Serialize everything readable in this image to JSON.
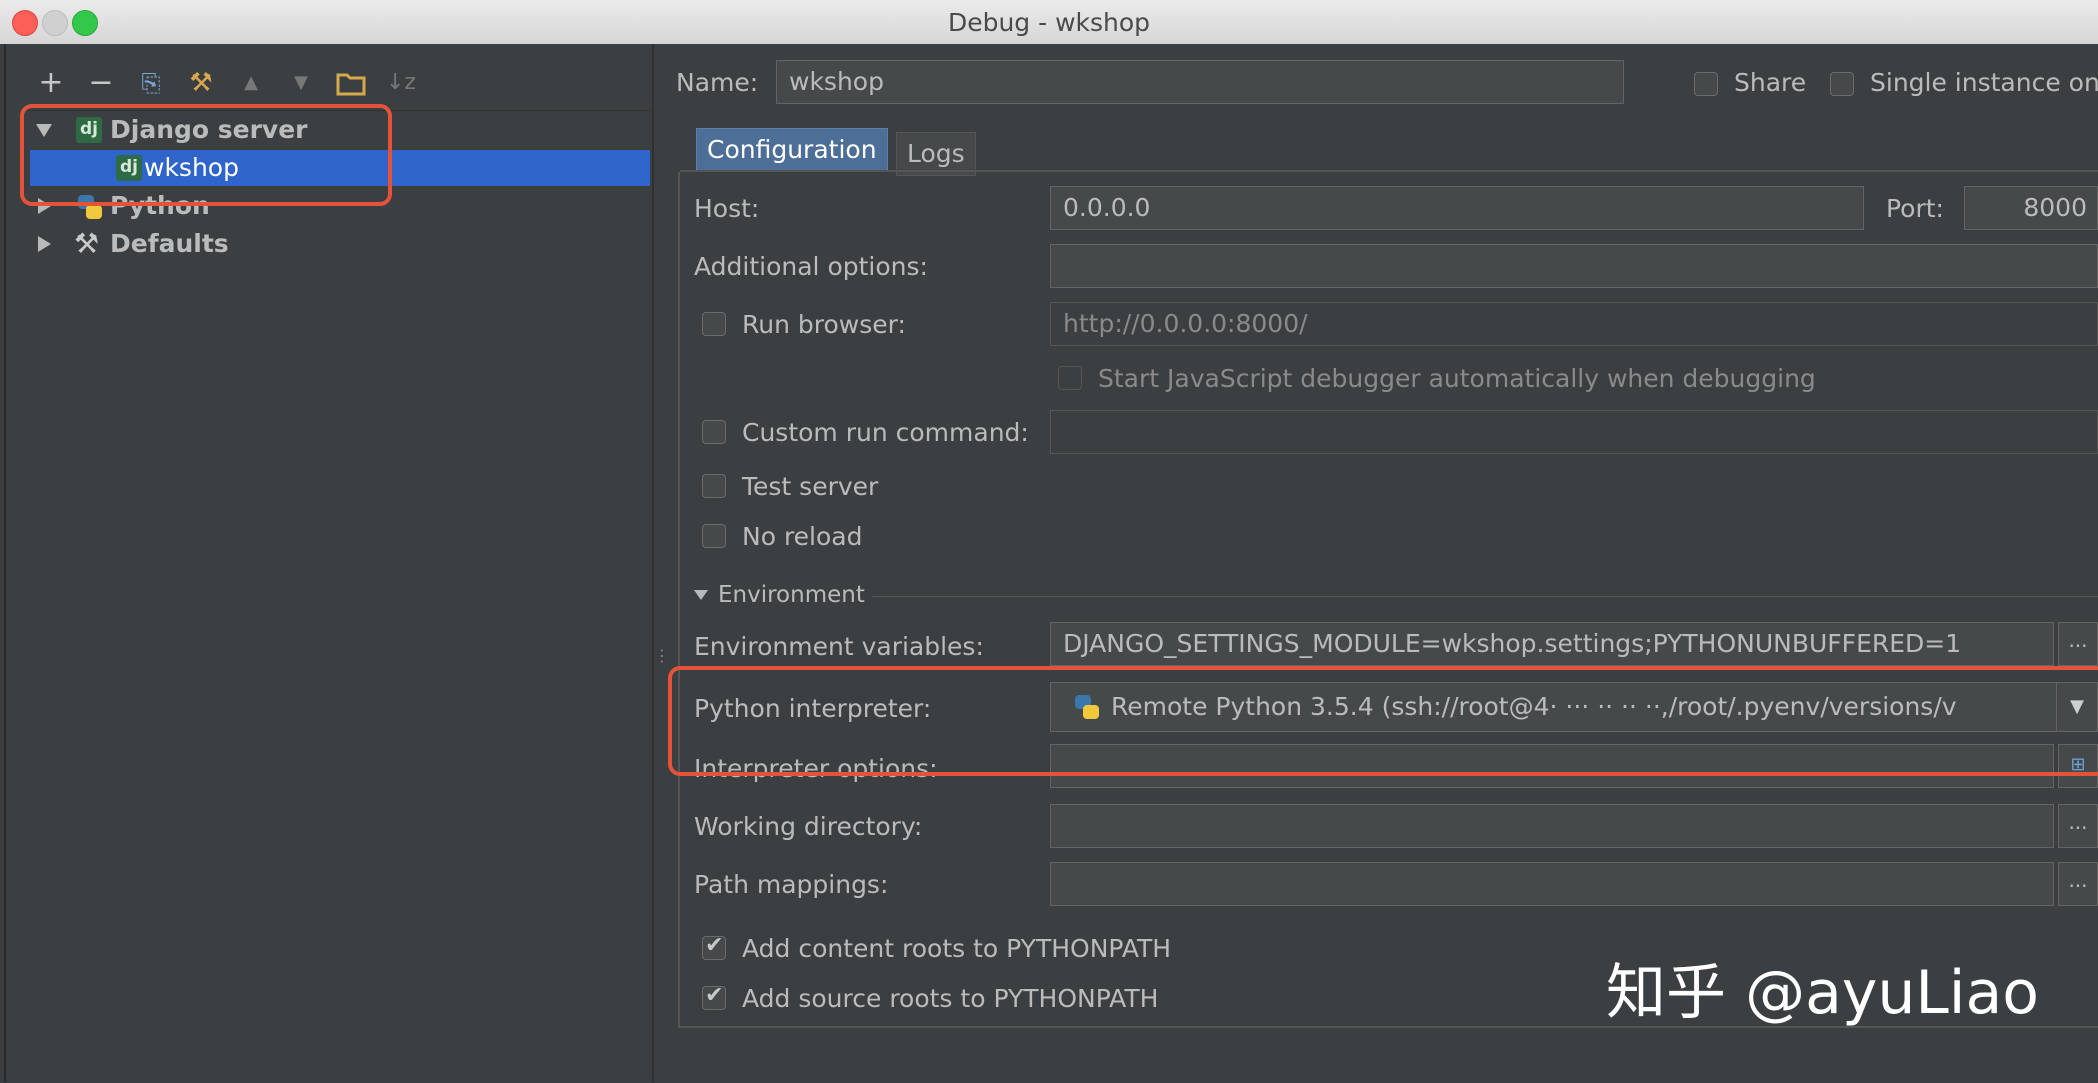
{
  "window": {
    "title": "Debug - wkshop"
  },
  "toolbar": {
    "add": "+",
    "remove": "−",
    "copy": "⎘",
    "edit_defaults": "⚒",
    "move_up": "▲",
    "move_down": "▼",
    "folder": "▭",
    "sort": "↓z"
  },
  "tree": {
    "items": [
      {
        "label": "Django server",
        "icon": "dj",
        "expanded": true,
        "bold": true
      },
      {
        "label": "wkshop",
        "icon": "dj",
        "selected": true
      },
      {
        "label": "Python",
        "icon": "python-icon",
        "expanded": false,
        "bold": true
      },
      {
        "label": "Defaults",
        "icon": "wrench-icon",
        "expanded": false,
        "bold": true
      }
    ]
  },
  "name_row": {
    "label": "Name:",
    "value": "wkshop",
    "share_label": "Share",
    "single_instance_label": "Single instance on"
  },
  "tabs": [
    {
      "label": "Configuration",
      "active": true
    },
    {
      "label": "Logs",
      "active": false
    }
  ],
  "config": {
    "host_label": "Host:",
    "host_value": "0.0.0.0",
    "port_label": "Port:",
    "port_value": "8000",
    "additional_options_label": "Additional options:",
    "additional_options_value": "",
    "run_browser_label": "Run browser:",
    "run_browser_value": "http://0.0.0.0:8000/",
    "js_debugger_label": "Start JavaScript debugger automatically when debugging",
    "custom_run_label": "Custom run command:",
    "custom_run_value": "",
    "test_server_label": "Test server",
    "no_reload_label": "No reload",
    "environment_header": "Environment",
    "env_vars_label": "Environment variables:",
    "env_vars_value": "DJANGO_SETTINGS_MODULE=wkshop.settings;PYTHONUNBUFFERED=1",
    "interpreter_label": "Python interpreter:",
    "interpreter_value": "Remote Python 3.5.4 (ssh://root@4·  ··· ·· ·· ··,/root/.pyenv/versions/v",
    "interpreter_options_label": "Interpreter options:",
    "working_dir_label": "Working directory:",
    "path_mappings_label": "Path mappings:",
    "content_roots_label": "Add content roots to PYTHONPATH",
    "source_roots_label": "Add source roots to PYTHONPATH",
    "browse": "..."
  },
  "watermark": "知乎 @ayuLiao",
  "colors": {
    "selection": "#2f65ca",
    "highlight_box": "#e2533a",
    "background": "#3c3f41"
  }
}
